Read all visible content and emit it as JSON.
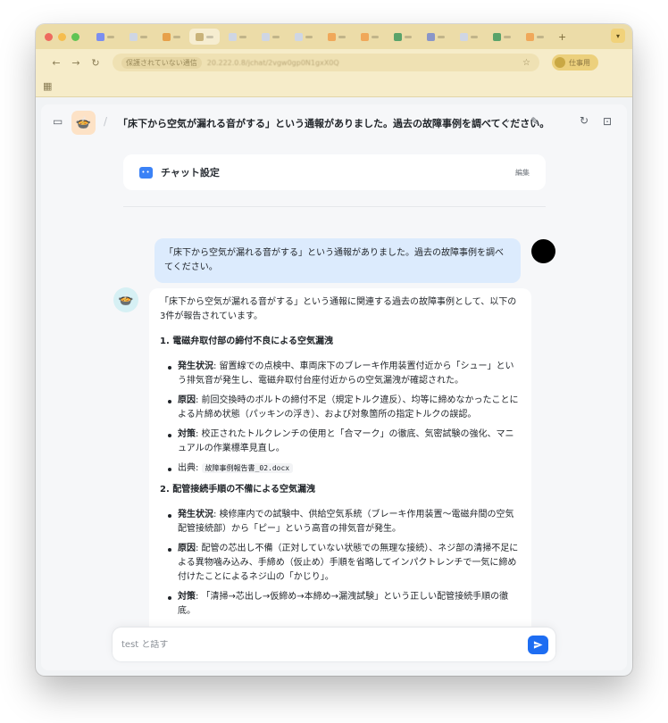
{
  "browser": {
    "security_label": "保護されていない通信",
    "url": "20.222.0.8/jchat/2vgw0gp0N1gxX0Q",
    "profile_label": "仕事用"
  },
  "header": {
    "title": "「床下から空気が漏れる音がする」という通報がありました。過去の故障事例を調べてください。"
  },
  "settings": {
    "title": "チャット設定",
    "edit_label": "編集"
  },
  "user_message": "「床下から空気が漏れる音がする」という通報がありました。過去の故障事例を調べてください。",
  "answer": {
    "intro": "「床下から空気が漏れる音がする」という通報に関連する過去の故障事例として、以下の3件が報告されています。",
    "cases": [
      {
        "heading": "1. 電磁弁取付部の締付不良による空気漏洩",
        "items": [
          {
            "label": "発生状況",
            "text": ": 留置線での点検中、車両床下のブレーキ作用装置付近から「シュー」という排気音が発生し、電磁弁取付台座付近からの空気漏洩が確認された。"
          },
          {
            "label": "原因",
            "text": ": 前回交換時のボルトの締付不足（規定トルク違反）、均等に締めなかったことによる片締め状態（パッキンの浮き）、および対象箇所の指定トルクの誤認。"
          },
          {
            "label": "対策",
            "text": ": 校正されたトルクレンチの使用と「合マーク」の徹底、気密試験の強化、マニュアルの作業標準見直し。"
          }
        ],
        "source_label": "出典: ",
        "source_file": "故障事例報告書_02.docx"
      },
      {
        "heading": "2. 配管接続手順の不備による空気漏洩",
        "items": [
          {
            "label": "発生状況",
            "text": ": 検修庫内での試験中、供給空気系統（ブレーキ作用装置〜電磁弁間の空気配管接続部）から「ピー」という高音の排気音が発生。"
          },
          {
            "label": "原因",
            "text": ": 配管の芯出し不備（正対していない状態での無理な接続）、ネジ部の清掃不足による異物噛み込み、手締め（仮止め）手順を省略してインパクトレンチで一気に締め付けたことによるネジ山の「かじり」。"
          },
          {
            "label": "対策",
            "text": ": 「清掃→芯出し→仮締め→本締め→漏洩試験」という正しい配管接続手順の徹底。"
          }
        ]
      }
    ]
  },
  "input": {
    "placeholder": "test と話す"
  }
}
